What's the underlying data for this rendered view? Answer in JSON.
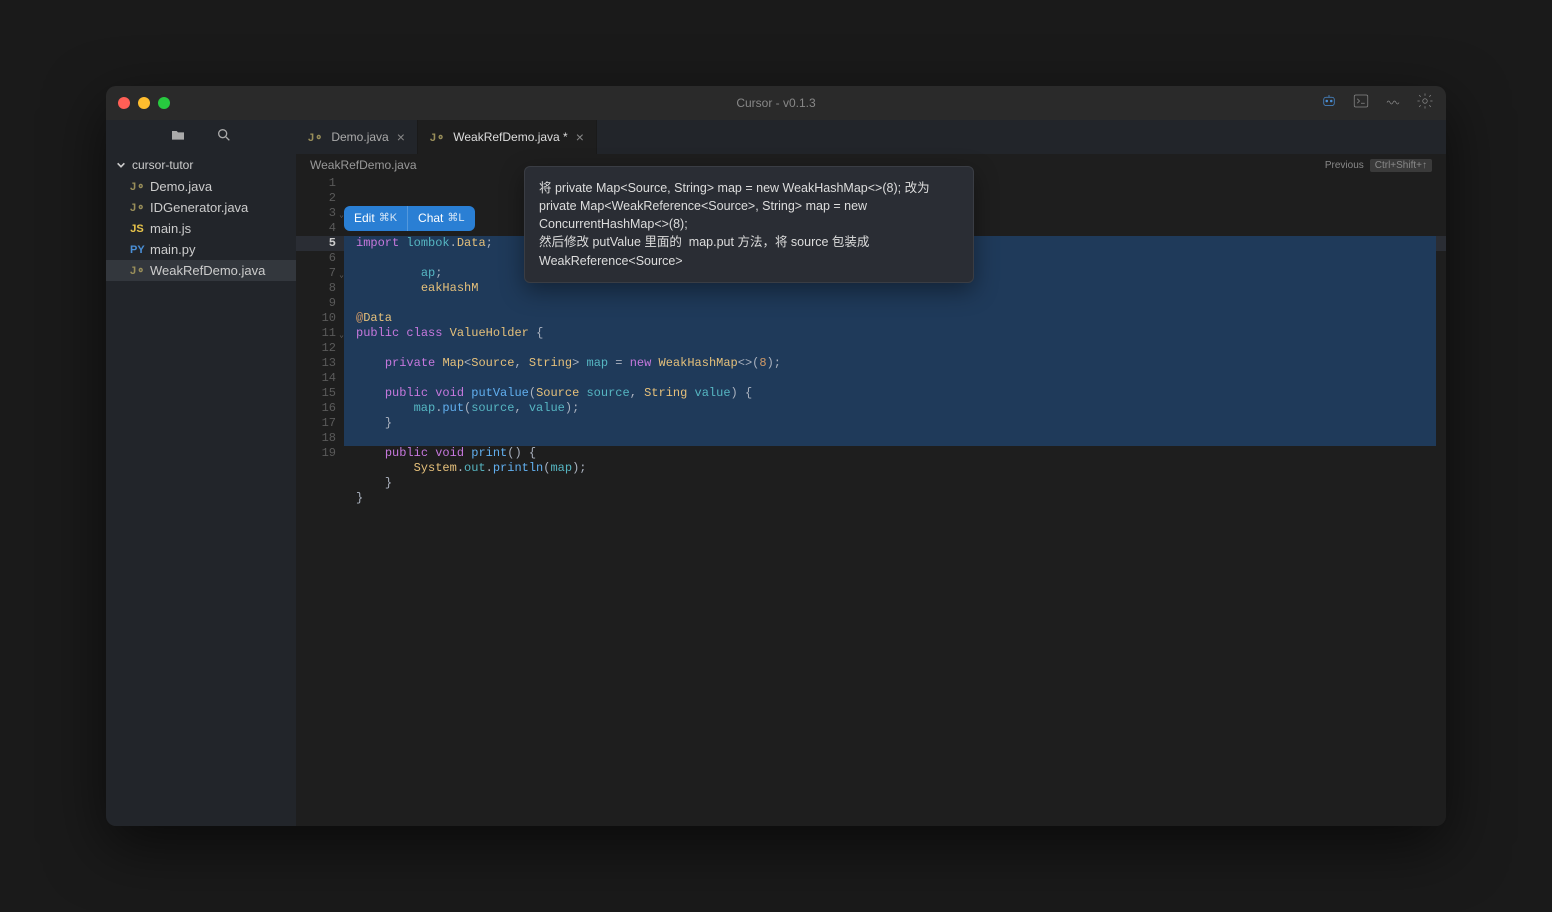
{
  "window": {
    "title": "Cursor - v0.1.3"
  },
  "sidebar": {
    "folder": "cursor-tutor",
    "files": [
      {
        "name": "Demo.java",
        "iconType": "java"
      },
      {
        "name": "IDGenerator.java",
        "iconType": "java"
      },
      {
        "name": "main.js",
        "iconType": "js"
      },
      {
        "name": "main.py",
        "iconType": "py"
      },
      {
        "name": "WeakRefDemo.java",
        "iconType": "java",
        "active": true
      }
    ]
  },
  "tabs": [
    {
      "label": "Demo.java",
      "iconType": "java",
      "modified": false,
      "active": false
    },
    {
      "label": "WeakRefDemo.java *",
      "iconType": "java",
      "modified": true,
      "active": true
    }
  ],
  "breadcrumb": {
    "path": "WeakRefDemo.java",
    "prevLabel": "Previous",
    "prevShortcut": "Ctrl+Shift+↑"
  },
  "aiButtons": {
    "edit": {
      "label": "Edit",
      "shortcut": "⌘K"
    },
    "chat": {
      "label": "Chat",
      "shortcut": "⌘L"
    }
  },
  "aiPopup": {
    "text": "将 private Map<Source, String> map = new WeakHashMap<>(8); 改为 private Map<WeakReference<Source>, String> map = new ConcurrentHashMap<>(8);\n然后修改 putValue 里面的  map.put 方法，将 source 包装成 WeakReference<Source>"
  },
  "code": {
    "currentLine": 5,
    "selectionStart": 5,
    "selectionEnd": 18,
    "lineCount": 19,
    "tokens": [
      [
        [
          "kw",
          "import"
        ],
        [
          "plain",
          " "
        ],
        [
          "ident",
          "lombok"
        ],
        [
          "punct",
          "."
        ],
        [
          "type",
          "Data"
        ],
        [
          "punct",
          ";"
        ]
      ],
      [],
      [
        [
          "plain",
          "         "
        ],
        [
          "ident",
          "ap"
        ],
        [
          "punct",
          ";"
        ]
      ],
      [
        [
          "plain",
          "         "
        ],
        [
          "type",
          "eakHashM"
        ]
      ],
      [],
      [
        [
          "anno",
          "@"
        ],
        [
          "type",
          "Data"
        ]
      ],
      [
        [
          "kw",
          "public"
        ],
        [
          "plain",
          " "
        ],
        [
          "kw",
          "class"
        ],
        [
          "plain",
          " "
        ],
        [
          "type",
          "ValueHolder"
        ],
        [
          "plain",
          " "
        ],
        [
          "punct",
          "{"
        ]
      ],
      [],
      [
        [
          "plain",
          "    "
        ],
        [
          "kw",
          "private"
        ],
        [
          "plain",
          " "
        ],
        [
          "type",
          "Map"
        ],
        [
          "punct",
          "<"
        ],
        [
          "type",
          "Source"
        ],
        [
          "punct",
          ", "
        ],
        [
          "type",
          "String"
        ],
        [
          "punct",
          "> "
        ],
        [
          "ident",
          "map"
        ],
        [
          "plain",
          " = "
        ],
        [
          "kw",
          "new"
        ],
        [
          "plain",
          " "
        ],
        [
          "type",
          "WeakHashMap"
        ],
        [
          "punct",
          "<>("
        ],
        [
          "num",
          "8"
        ],
        [
          "punct",
          ");"
        ]
      ],
      [],
      [
        [
          "plain",
          "    "
        ],
        [
          "kw",
          "public"
        ],
        [
          "plain",
          " "
        ],
        [
          "kw",
          "void"
        ],
        [
          "plain",
          " "
        ],
        [
          "fn",
          "putValue"
        ],
        [
          "punct",
          "("
        ],
        [
          "type",
          "Source"
        ],
        [
          "plain",
          " "
        ],
        [
          "ident",
          "source"
        ],
        [
          "punct",
          ", "
        ],
        [
          "type",
          "String"
        ],
        [
          "plain",
          " "
        ],
        [
          "ident",
          "value"
        ],
        [
          "punct",
          ") {"
        ]
      ],
      [
        [
          "plain",
          "        "
        ],
        [
          "ident",
          "map"
        ],
        [
          "punct",
          "."
        ],
        [
          "fn",
          "put"
        ],
        [
          "punct",
          "("
        ],
        [
          "ident",
          "source"
        ],
        [
          "punct",
          ", "
        ],
        [
          "ident",
          "value"
        ],
        [
          "punct",
          ");"
        ]
      ],
      [
        [
          "plain",
          "    "
        ],
        [
          "punct",
          "}"
        ]
      ],
      [],
      [
        [
          "plain",
          "    "
        ],
        [
          "kw",
          "public"
        ],
        [
          "plain",
          " "
        ],
        [
          "kw",
          "void"
        ],
        [
          "plain",
          " "
        ],
        [
          "fn",
          "print"
        ],
        [
          "punct",
          "() {"
        ]
      ],
      [
        [
          "plain",
          "        "
        ],
        [
          "type",
          "System"
        ],
        [
          "punct",
          "."
        ],
        [
          "ident",
          "out"
        ],
        [
          "punct",
          "."
        ],
        [
          "fn",
          "println"
        ],
        [
          "punct",
          "("
        ],
        [
          "ident",
          "map"
        ],
        [
          "punct",
          ");"
        ]
      ],
      [
        [
          "plain",
          "    "
        ],
        [
          "punct",
          "}"
        ]
      ],
      [
        [
          "punct",
          "}"
        ]
      ],
      []
    ],
    "foldLines": [
      3,
      7,
      11
    ]
  }
}
